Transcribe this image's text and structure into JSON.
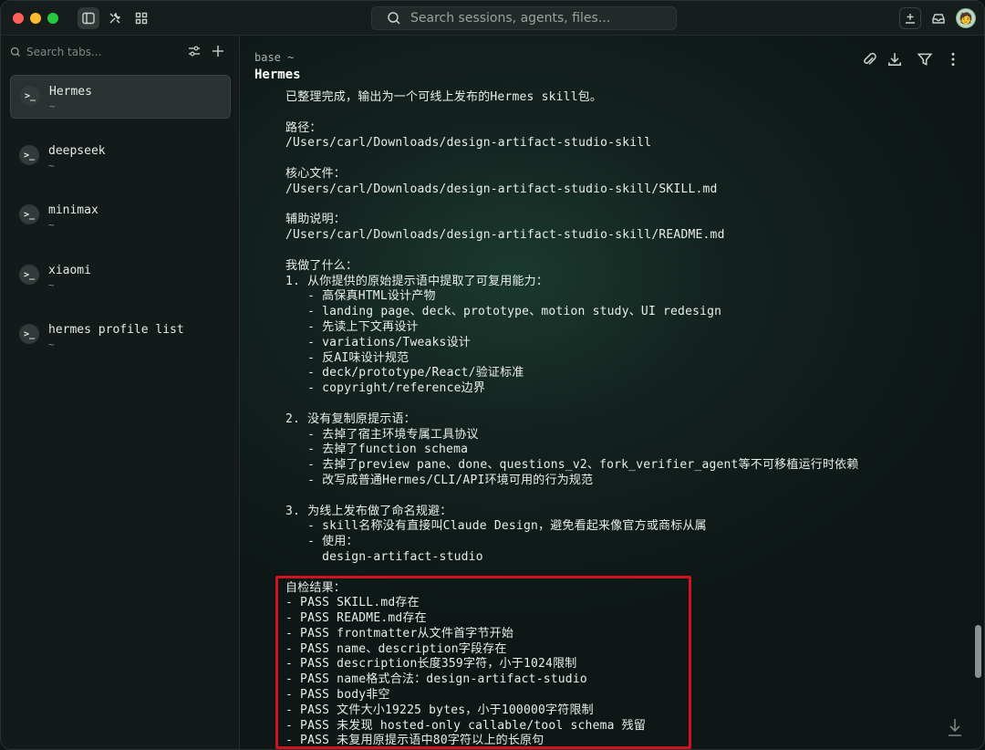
{
  "titlebar": {
    "search_placeholder": "Search sessions, agents, files...",
    "avatar_glyph": "🧑"
  },
  "sidebar": {
    "search_placeholder": "Search tabs...",
    "sessions": [
      {
        "name": "Hermes",
        "sub": "~",
        "active": true
      },
      {
        "name": "deepseek",
        "sub": "~"
      },
      {
        "name": "minimax",
        "sub": "~"
      },
      {
        "name": "xiaomi",
        "sub": "~"
      },
      {
        "name": "hermes profile list",
        "sub": "~"
      }
    ],
    "term_glyph": ">_"
  },
  "main": {
    "breadcrumb": "base ~",
    "title": "Hermes",
    "lines": [
      "已整理完成，输出为一个可线上发布的Hermes skill包。",
      "",
      "路径：",
      "/Users/carl/Downloads/design-artifact-studio-skill",
      "",
      "核心文件：",
      "/Users/carl/Downloads/design-artifact-studio-skill/SKILL.md",
      "",
      "辅助说明：",
      "/Users/carl/Downloads/design-artifact-studio-skill/README.md",
      "",
      "我做了什么：",
      "1. 从你提供的原始提示语中提取了可复用能力：",
      "   - 高保真HTML设计产物",
      "   - landing page、deck、prototype、motion study、UI redesign",
      "   - 先读上下文再设计",
      "   - variations/Tweaks设计",
      "   - 反AI味设计规范",
      "   - deck/prototype/React/验证标准",
      "   - copyright/reference边界",
      "",
      "2. 没有复制原提示语：",
      "   - 去掉了宿主环境专属工具协议",
      "   - 去掉了function schema",
      "   - 去掉了preview pane、done、questions_v2、fork_verifier_agent等不可移植运行时依赖",
      "   - 改写成普通Hermes/CLI/API环境可用的行为规范",
      "",
      "3. 为线上发布做了命名规避：",
      "   - skill名称没有直接叫Claude Design，避免看起来像官方或商标从属",
      "   - 使用：",
      "     design-artifact-studio",
      "",
      "自检结果：",
      "- PASS SKILL.md存在",
      "- PASS README.md存在",
      "- PASS frontmatter从文件首字节开始",
      "- PASS name、description字段存在",
      "- PASS description长度359字符，小于1024限制",
      "- PASS name格式合法：design-artifact-studio",
      "- PASS body非空",
      "- PASS 文件大小19225 bytes，小于100000字符限制",
      "- PASS 未发现 hosted-only callable/tool schema 残留",
      "- PASS 未复用原提示语中80字符以上的长原句"
    ]
  }
}
